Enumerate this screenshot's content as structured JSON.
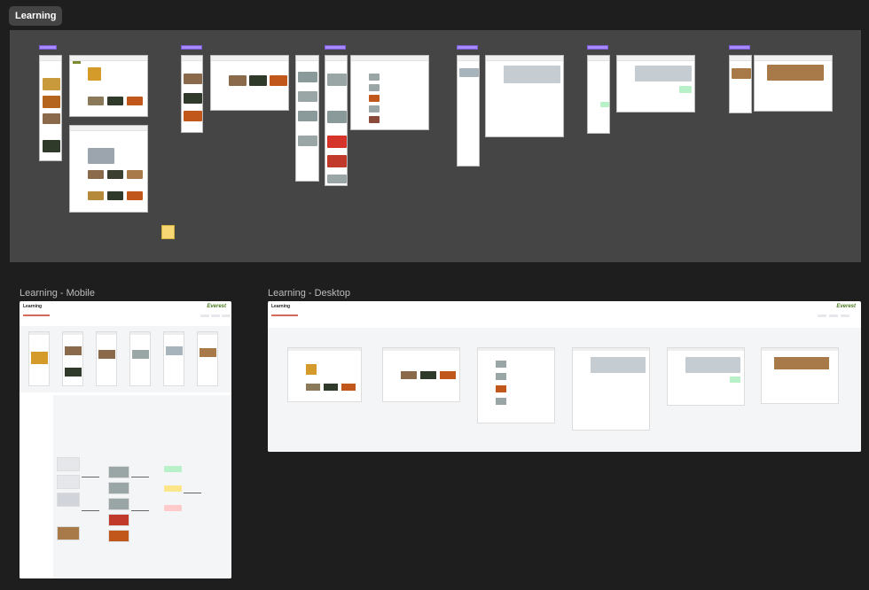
{
  "page": {
    "title": "Learning"
  },
  "boards": {
    "mobile_title": "Learning - Mobile",
    "desktop_title": "Learning - Desktop",
    "heading": "Learning",
    "brand": "Everest"
  },
  "colors": {
    "background": "#1e1e1e",
    "section": "#454545",
    "tag_purple": "#a78bfa",
    "sticky": "#f7d774",
    "brand_green": "#4a7a1e"
  }
}
